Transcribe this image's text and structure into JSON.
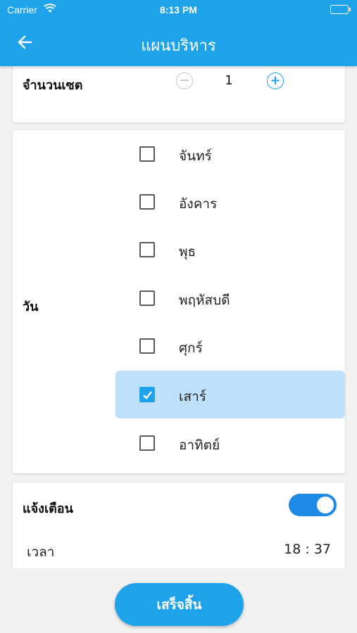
{
  "status_bar": {
    "carrier": "Carrier",
    "time": "8:13 PM"
  },
  "header": {
    "title": "แผนบริหาร",
    "back_icon": "arrow-left-icon"
  },
  "sets": {
    "label": "จำนวนเซต",
    "value": "1",
    "minus": "−",
    "plus": "+"
  },
  "days": {
    "label": "วัน",
    "items": [
      {
        "label": "จันทร์",
        "checked": false
      },
      {
        "label": "อังคาร",
        "checked": false
      },
      {
        "label": "พุธ",
        "checked": false
      },
      {
        "label": "พฤหัสบดี",
        "checked": false
      },
      {
        "label": "ศุกร์",
        "checked": false
      },
      {
        "label": "เสาร์",
        "checked": true
      },
      {
        "label": "อาทิตย์",
        "checked": false
      }
    ]
  },
  "notify": {
    "label": "แจ้งเตือน",
    "enabled": true,
    "time_label": "เวลา",
    "time_value": "18 : 37"
  },
  "footer": {
    "finish_label": "เสร็จสิ้น"
  },
  "colors": {
    "accent": "#1ea3ea",
    "selected_row": "#bee0fa",
    "toggle_on": "#1e8ae6"
  }
}
